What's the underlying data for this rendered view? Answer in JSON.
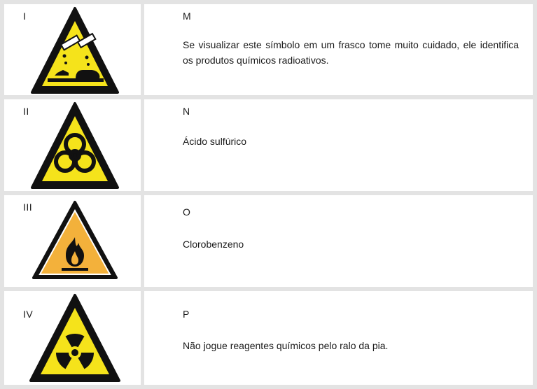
{
  "rows": [
    {
      "numeral": "I",
      "sign_icon": "corrosive-icon",
      "letter": "M",
      "text": "Se visualizar este símbolo em um frasco tome muito cuidado, ele identifica os produtos químicos radioativos."
    },
    {
      "numeral": "II",
      "sign_icon": "biohazard-icon",
      "letter": "N",
      "text": "Ácido sulfúrico"
    },
    {
      "numeral": "III",
      "sign_icon": "flammable-icon",
      "letter": "O",
      "text": "Clorobenzeno"
    },
    {
      "numeral": "IV",
      "sign_icon": "radioactive-icon",
      "letter": "P",
      "text": "Não jogue reagentes químicos pelo ralo da pia."
    }
  ],
  "colors": {
    "warning_yellow": "#f5e31b",
    "flammable_orange": "#f3b13b",
    "border_black": "#111111",
    "grid_gray": "#e3e3e3"
  }
}
